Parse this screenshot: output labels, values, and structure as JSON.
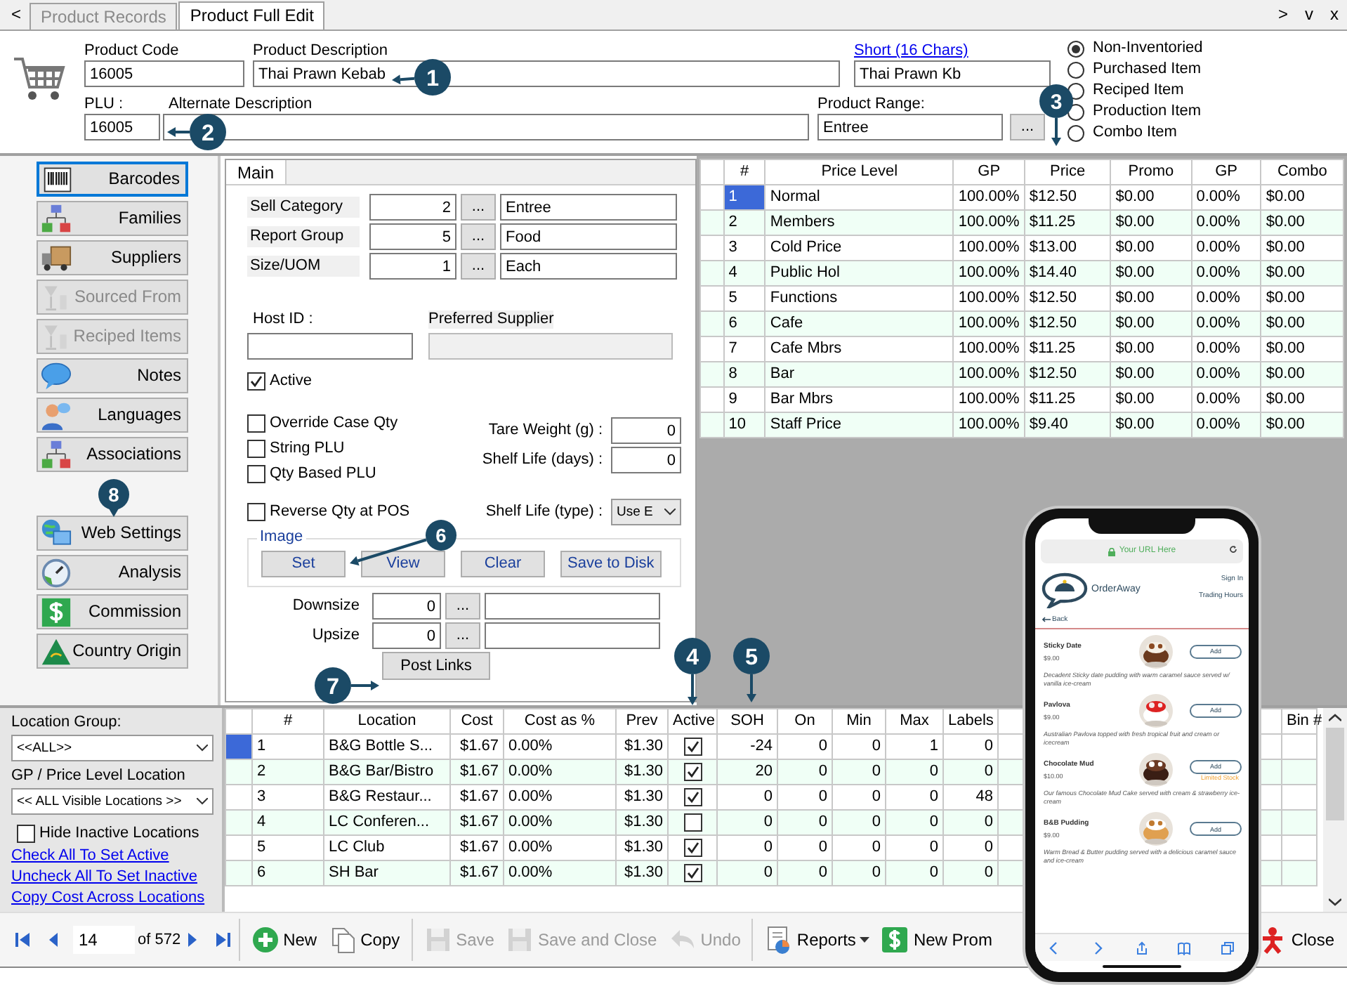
{
  "tabs": {
    "back": "<",
    "items": [
      {
        "label": "Product Records",
        "selected": false
      },
      {
        "label": "Product Full Edit",
        "selected": true
      }
    ],
    "controls": [
      ">",
      "v",
      "x"
    ]
  },
  "product": {
    "code_label": "Product Code",
    "code": "16005",
    "description_label": "Product Description",
    "description": "Thai Prawn Kebab",
    "short_label": "Short (16 Chars)",
    "short": "Thai Prawn Kb",
    "plu_label": "PLU :",
    "plu": "16005",
    "alt_label": "Alternate Description",
    "range_label": "Product Range:",
    "range": "Entree",
    "range_button": "..."
  },
  "product_types": [
    {
      "label": "Non-Inventoried",
      "selected": true
    },
    {
      "label": "Purchased Item",
      "selected": false
    },
    {
      "label": "Reciped Item",
      "selected": false
    },
    {
      "label": "Production Item",
      "selected": false
    },
    {
      "label": "Combo Item",
      "selected": false
    }
  ],
  "sidebar": [
    [
      {
        "label": "Barcodes",
        "selected": true,
        "disabled": false
      },
      {
        "label": "Families",
        "selected": false,
        "disabled": false
      },
      {
        "label": "Suppliers",
        "selected": false,
        "disabled": false
      },
      {
        "label": "Sourced From",
        "selected": false,
        "disabled": true
      },
      {
        "label": "Reciped Items",
        "selected": false,
        "disabled": true
      },
      {
        "label": "Notes",
        "selected": false,
        "disabled": false
      },
      {
        "label": "Languages",
        "selected": false,
        "disabled": false
      },
      {
        "label": "Associations",
        "selected": false,
        "disabled": false
      }
    ],
    [
      {
        "label": "Web Settings",
        "selected": false,
        "disabled": false
      },
      {
        "label": "Analysis",
        "selected": false,
        "disabled": false
      },
      {
        "label": "Commission",
        "selected": false,
        "disabled": false
      },
      {
        "label": "Country Origin",
        "selected": false,
        "disabled": false
      }
    ]
  ],
  "main_tab": "Main",
  "lookups": [
    {
      "label": "Sell Category",
      "number": "2",
      "button": "...",
      "value": "Entree"
    },
    {
      "label": "Report Group",
      "number": "5",
      "button": "...",
      "value": "Food"
    },
    {
      "label": "Size/UOM",
      "number": "1",
      "button": "...",
      "value": "Each"
    }
  ],
  "host_id_label": "Host ID :",
  "preferred_supplier_label": "Preferred Supplier",
  "active": {
    "label": "Active",
    "checked": true
  },
  "options": [
    {
      "label": "Override Case Qty",
      "checked": false
    },
    {
      "label": "String PLU",
      "checked": false
    },
    {
      "label": "Qty Based PLU",
      "checked": false
    }
  ],
  "measures": [
    {
      "label": "Tare Weight (g) :",
      "value": "0"
    },
    {
      "label": "Shelf Life (days) :",
      "value": "0"
    }
  ],
  "reverse_qty": {
    "label": "Reverse Qty at POS",
    "checked": false
  },
  "shelf_life_type": {
    "label": "Shelf Life (type) :",
    "value": "Use E"
  },
  "image": {
    "title": "Image",
    "buttons": [
      "Set",
      "View",
      "Clear",
      "Save to Disk"
    ]
  },
  "size_links": [
    {
      "label": "Downsize",
      "number": "0",
      "button": "..."
    },
    {
      "label": "Upsize",
      "number": "0",
      "button": "..."
    }
  ],
  "post_links": "Post Links",
  "price_table": {
    "columns": [
      "#",
      "Price Level",
      "GP",
      "Price",
      "Promo",
      "GP",
      "Combo"
    ],
    "rows": [
      {
        "cells": [
          "1",
          "Normal",
          "100.00%",
          "$12.50",
          "$0.00",
          "0.00%",
          "$0.00"
        ],
        "selected": true
      },
      {
        "cells": [
          "2",
          "Members",
          "100.00%",
          "$11.25",
          "$0.00",
          "0.00%",
          "$0.00"
        ],
        "selected": false
      },
      {
        "cells": [
          "3",
          "Cold Price",
          "100.00%",
          "$13.00",
          "$0.00",
          "0.00%",
          "$0.00"
        ],
        "selected": false
      },
      {
        "cells": [
          "4",
          "Public Hol",
          "100.00%",
          "$14.40",
          "$0.00",
          "0.00%",
          "$0.00"
        ],
        "selected": false
      },
      {
        "cells": [
          "5",
          "Functions",
          "100.00%",
          "$12.50",
          "$0.00",
          "0.00%",
          "$0.00"
        ],
        "selected": false
      },
      {
        "cells": [
          "6",
          "Cafe",
          "100.00%",
          "$12.50",
          "$0.00",
          "0.00%",
          "$0.00"
        ],
        "selected": false
      },
      {
        "cells": [
          "7",
          "Cafe Mbrs",
          "100.00%",
          "$11.25",
          "$0.00",
          "0.00%",
          "$0.00"
        ],
        "selected": false
      },
      {
        "cells": [
          "8",
          "Bar",
          "100.00%",
          "$12.50",
          "$0.00",
          "0.00%",
          "$0.00"
        ],
        "selected": false
      },
      {
        "cells": [
          "9",
          "Bar Mbrs",
          "100.00%",
          "$11.25",
          "$0.00",
          "0.00%",
          "$0.00"
        ],
        "selected": false
      },
      {
        "cells": [
          "10",
          "Staff Price",
          "100.00%",
          "$9.40",
          "$0.00",
          "0.00%",
          "$0.00"
        ],
        "selected": false
      }
    ]
  },
  "location_filter": {
    "group_label": "Location Group:",
    "group": "<<ALL>>",
    "level_label": "GP / Price Level Location",
    "level": "<< ALL Visible Locations >>",
    "hide_inactive": {
      "label": "Hide Inactive Locations",
      "checked": false
    },
    "links": [
      "Check All To Set Active",
      "Uncheck All To Set Inactive",
      "Copy Cost Across Locations"
    ]
  },
  "locations": {
    "columns": [
      "#",
      "Location",
      "Cost",
      "Cost as %",
      "Prev",
      "Active",
      "SOH",
      "On",
      "Min",
      "Max",
      "Labels",
      "Bin #"
    ],
    "rows": [
      {
        "number": "1",
        "location": "B&G Bottle S...",
        "cost": "$1.67",
        "cost_pct": "0.00%",
        "prev": "$1.30",
        "active": true,
        "soh": "-24",
        "on": "0",
        "min": "0",
        "max": "1",
        "labels": "0",
        "selected": true
      },
      {
        "number": "2",
        "location": "B&G Bar/Bistro",
        "cost": "$1.67",
        "cost_pct": "0.00%",
        "prev": "$1.30",
        "active": true,
        "soh": "20",
        "on": "0",
        "min": "0",
        "max": "0",
        "labels": "0",
        "selected": false
      },
      {
        "number": "3",
        "location": "B&G Restaur...",
        "cost": "$1.67",
        "cost_pct": "0.00%",
        "prev": "$1.30",
        "active": true,
        "soh": "0",
        "on": "0",
        "min": "0",
        "max": "0",
        "labels": "48",
        "selected": false
      },
      {
        "number": "4",
        "location": "LC Conferen...",
        "cost": "$1.67",
        "cost_pct": "0.00%",
        "prev": "$1.30",
        "active": false,
        "soh": "0",
        "on": "0",
        "min": "0",
        "max": "0",
        "labels": "0",
        "selected": false
      },
      {
        "number": "5",
        "location": "LC Club",
        "cost": "$1.67",
        "cost_pct": "0.00%",
        "prev": "$1.30",
        "active": true,
        "soh": "0",
        "on": "0",
        "min": "0",
        "max": "0",
        "labels": "0",
        "selected": false
      },
      {
        "number": "6",
        "location": "SH Bar",
        "cost": "$1.67",
        "cost_pct": "0.00%",
        "prev": "$1.30",
        "active": true,
        "soh": "0",
        "on": "0",
        "min": "0",
        "max": "0",
        "labels": "0",
        "selected": false
      }
    ]
  },
  "toolbar": {
    "record": "14",
    "of": "of 572",
    "buttons": [
      {
        "label": "New",
        "disabled": false,
        "dropdown": false
      },
      {
        "label": "Copy",
        "disabled": false,
        "dropdown": false
      },
      {
        "label": "Save",
        "disabled": true,
        "dropdown": false
      },
      {
        "label": "Save and Close",
        "disabled": true,
        "dropdown": false
      },
      {
        "label": "Undo",
        "disabled": true,
        "dropdown": false
      },
      {
        "label": "Reports",
        "disabled": false,
        "dropdown": true
      },
      {
        "label": "New Prom",
        "disabled": false,
        "dropdown": false
      }
    ],
    "close": "Close"
  },
  "phone": {
    "url": "Your URL Here",
    "brand": "OrderAway",
    "links": [
      "Sign In",
      "Trading Hours"
    ],
    "back": "Back",
    "items": [
      {
        "name": "Sticky Date",
        "price": "$9.00",
        "description": "Decadent Sticky date pudding with warm caramel sauce served w/ vanilla ice-cream",
        "button": "Add"
      },
      {
        "name": "Pavlova",
        "price": "$9.00",
        "description": "Australian Pavlova topped with fresh tropical fruit and cream or icecream",
        "button": "Add"
      },
      {
        "name": "Chocolate Mud",
        "price": "$10.00",
        "description": "Our famous Chocolate Mud Cake served with cream & strawberry ice-cream",
        "button": "Add",
        "note": "Limited Stock"
      },
      {
        "name": "B&B Pudding",
        "price": "$9.00",
        "description": "Warm Bread & Butter pudding served with a delicious caramel sauce and ice-cream",
        "button": "Add"
      }
    ]
  },
  "callouts": [
    "1",
    "2",
    "3",
    "4",
    "5",
    "6",
    "7",
    "8"
  ]
}
